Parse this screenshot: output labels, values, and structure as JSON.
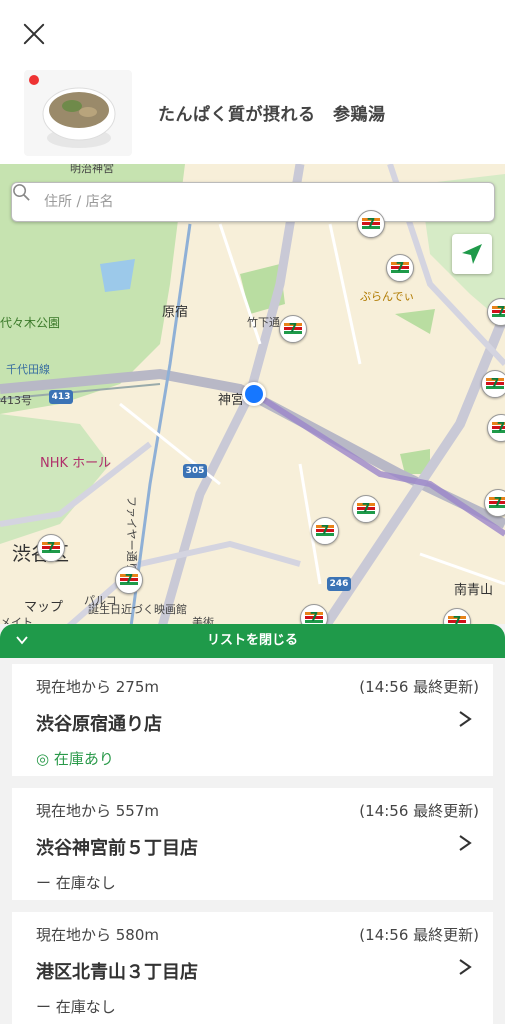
{
  "header": {
    "close_icon": "close-icon"
  },
  "product": {
    "title": "たんぱく質が摂れる　参鶏湯",
    "image_icon": "soup-bowl-image"
  },
  "map": {
    "search": {
      "placeholder": "住所 / 店名",
      "value": ""
    },
    "locate_icon": "location-arrow-icon",
    "labels": {
      "meiji": "明治神宮",
      "yoyogi": "代々木公園",
      "harajuku": "原宿",
      "takeshita": "竹下通",
      "jingu": "神宮",
      "chiyoda": "千代田線",
      "route413": "413号",
      "nhk": "NHK ホール",
      "shibuya": "渋谷区",
      "minamiaoyama": "南青山",
      "maps": "マップ",
      "parco": "パルコ",
      "bikkuri": "誕生日近づく映画館",
      "puran": "ぷらんでぃ",
      "fire": "ファイヤー通り",
      "me": "メイト",
      "bijutsu": "美術"
    },
    "shields": {
      "r413": "413",
      "r305": "305",
      "r246": "246"
    },
    "brand_colors": {
      "orange": "#e8831a",
      "red": "#d0121b",
      "green": "#1f9a4a"
    }
  },
  "sheet": {
    "header_label": "リストを閉じる",
    "collapse_icon": "chevron-down-icon",
    "stores": [
      {
        "distance": "現在地から 275m",
        "updated": "(14:56 最終更新)",
        "name": "渋谷原宿通り店",
        "stock": "◎ 在庫あり",
        "in_stock": true
      },
      {
        "distance": "現在地から 557m",
        "updated": "(14:56 最終更新)",
        "name": "渋谷神宮前５丁目店",
        "stock": "ー 在庫なし",
        "in_stock": false
      },
      {
        "distance": "現在地から 580m",
        "updated": "(14:56 最終更新)",
        "name": "港区北青山３丁目店",
        "stock": "ー 在庫なし",
        "in_stock": false
      }
    ]
  },
  "colors": {
    "accent": "#1f9a4a",
    "user_location": "#1677ff"
  }
}
